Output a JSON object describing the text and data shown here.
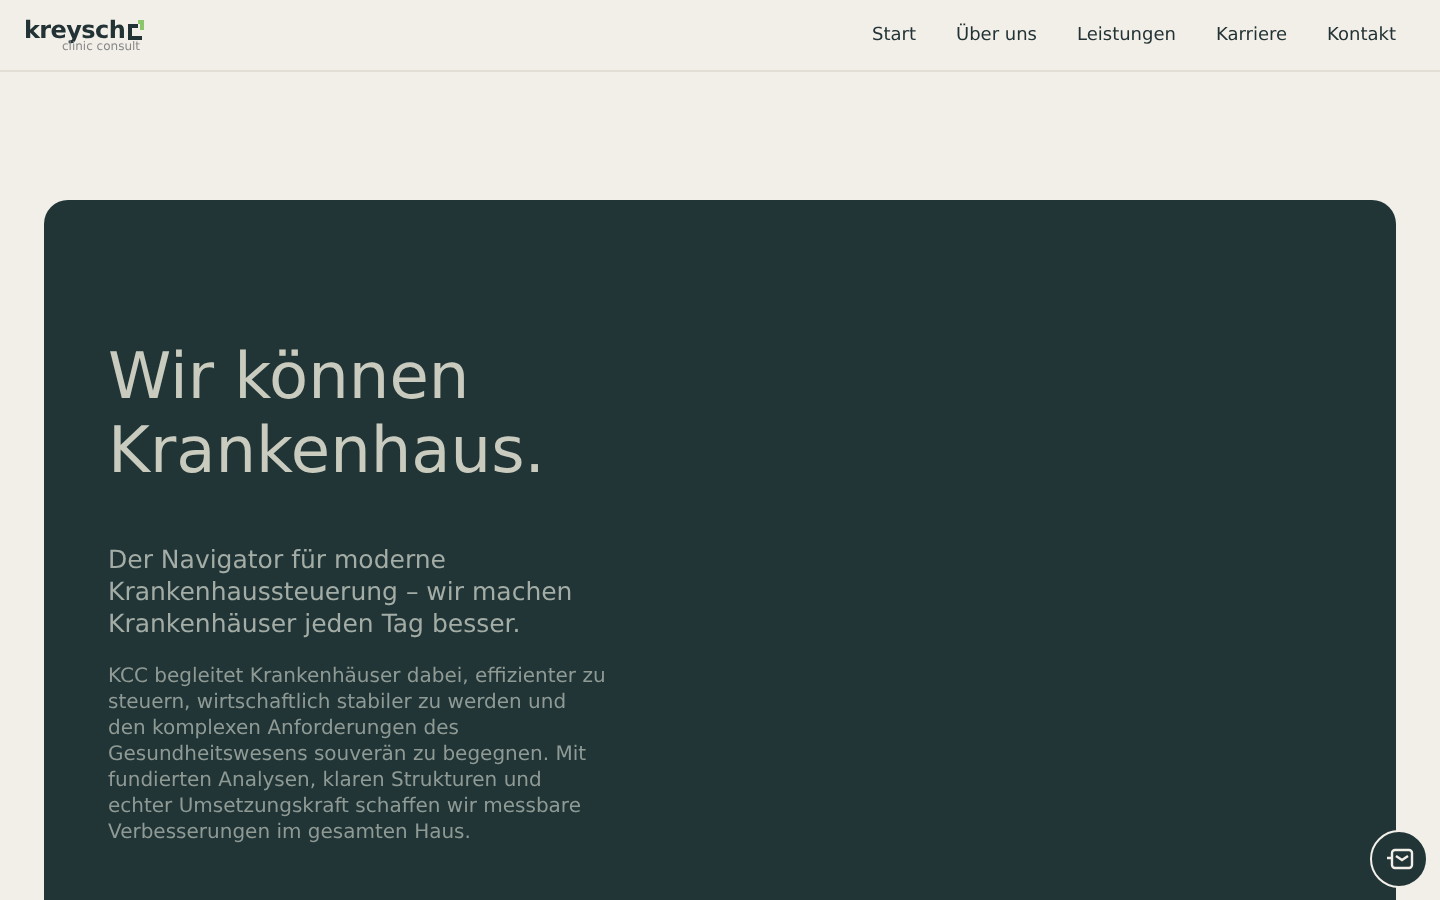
{
  "header": {
    "logo": {
      "name": "kreysch",
      "tagline": "clinic consult"
    },
    "nav": [
      {
        "label": "Start"
      },
      {
        "label": "Über uns"
      },
      {
        "label": "Leistungen"
      },
      {
        "label": "Karriere"
      },
      {
        "label": "Kontakt"
      }
    ]
  },
  "hero": {
    "title_lines": [
      "Wir können",
      "Krankenhaus."
    ],
    "lead": "Der Navigator für moderne Krankenhaussteuerung – wir machen Krankenhäuser jeden Tag besser.",
    "body": "KCC begleitet Krankenhäuser dabei, effizienter zu steuern, wirtschaftlich stabiler zu werden und den komplexen Anforderungen des Gesundheitswesens souverän zu begegnen. Mit fundierten Analysen, klaren Strukturen und echter Umsetzungskraft schaffen wir messbare Verbesserungen im gesamten Haus."
  }
}
